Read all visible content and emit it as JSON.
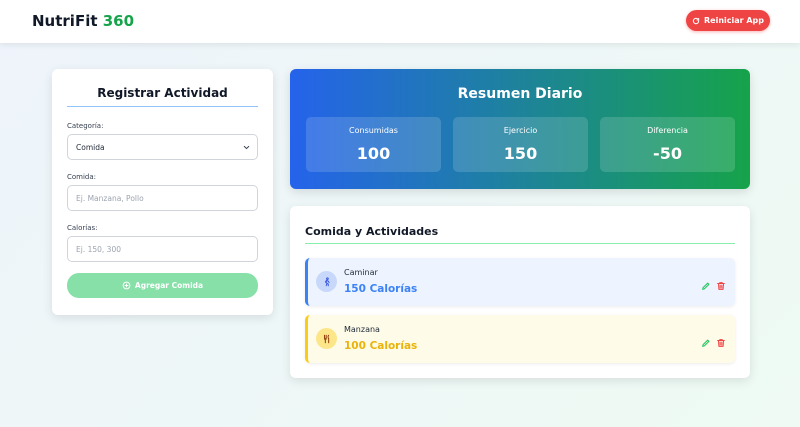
{
  "header": {
    "brand_main": "NutriFit",
    "brand_accent": "360",
    "reset_label": "Reiniciar App"
  },
  "form": {
    "title": "Registrar Actividad",
    "category_label": "Categoría:",
    "category_value": "Comida",
    "name_label": "Comida:",
    "name_placeholder": "Ej. Manzana, Pollo",
    "calories_label": "Calorías:",
    "calories_placeholder": "Ej. 150, 300",
    "submit_label": "Agregar Comida"
  },
  "summary": {
    "title": "Resumen Diario",
    "stats": [
      {
        "label": "Consumidas",
        "value": "100"
      },
      {
        "label": "Ejercicio",
        "value": "150"
      },
      {
        "label": "Diferencia",
        "value": "-50"
      }
    ]
  },
  "list": {
    "title": "Comida y Actividades",
    "items": [
      {
        "name": "Caminar",
        "calories": "150 Calorías",
        "icon": "walking-icon",
        "kind": "activity"
      },
      {
        "name": "Manzana",
        "calories": "100 Calorías",
        "icon": "utensils-icon",
        "kind": "food"
      }
    ]
  },
  "colors": {
    "brand_accent": "#16a34a",
    "reset": "#ef4444",
    "activity": "#3b82f6",
    "food": "#eab308",
    "edit": "#22c55e",
    "delete": "#ef4444"
  }
}
